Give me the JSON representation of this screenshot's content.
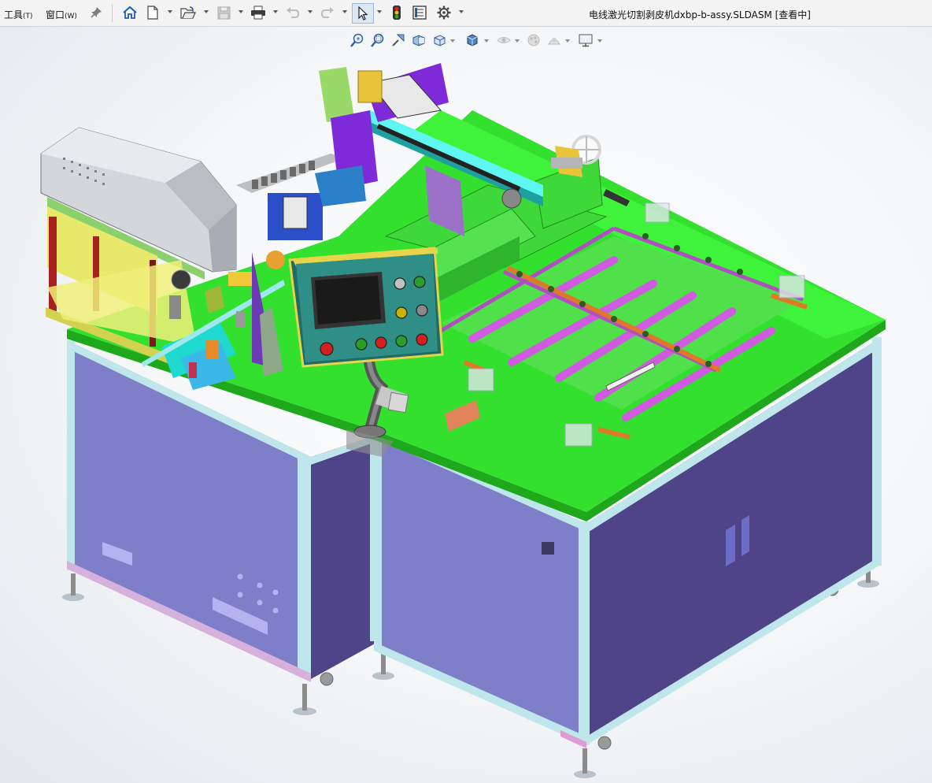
{
  "menu": {
    "tools": {
      "label": "工具",
      "accel": "(T)"
    },
    "window": {
      "label": "窗口",
      "accel": "(W)"
    }
  },
  "window": {
    "title": "电线激光切割剥皮机dxbp-b-assy.SLDASM [查看中]"
  },
  "toolbar": {
    "buttons": [
      "pin-icon",
      "home-icon",
      "new-document-icon",
      "open-icon",
      "save-icon",
      "print-icon",
      "undo-icon",
      "redo-icon",
      "select-pointer-icon",
      "rebuild-traffic-light-icon",
      "file-properties-icon",
      "options-gear-icon"
    ],
    "active_tool": "select-pointer-icon"
  },
  "view_toolbar": {
    "buttons": [
      "zoom-to-fit-icon",
      "zoom-to-area-icon",
      "previous-view-icon",
      "section-view-icon",
      "view-orientation-icon",
      "display-style-icon",
      "hide-show-items-icon",
      "edit-appearance-icon",
      "apply-scene-icon",
      "view-settings-icon"
    ]
  },
  "model": {
    "panel_buttons": [
      "#c0c0c0",
      "#2a9d2a",
      "#c8b400",
      "#8a8a8a",
      "#d62020",
      "#2a9d2a",
      "#d62020",
      "#2a9d2a",
      "#d62020"
    ]
  },
  "colors": {
    "table_top": "#33e02e",
    "cabinet_panel": "#7f7fc9",
    "cabinet_dark": "#4f4488",
    "frame": "#bfe6ea",
    "magenta_rail": "#d05ae0",
    "panel_teal": "#2f8f86",
    "housing_gray": "#c9ccd1"
  }
}
